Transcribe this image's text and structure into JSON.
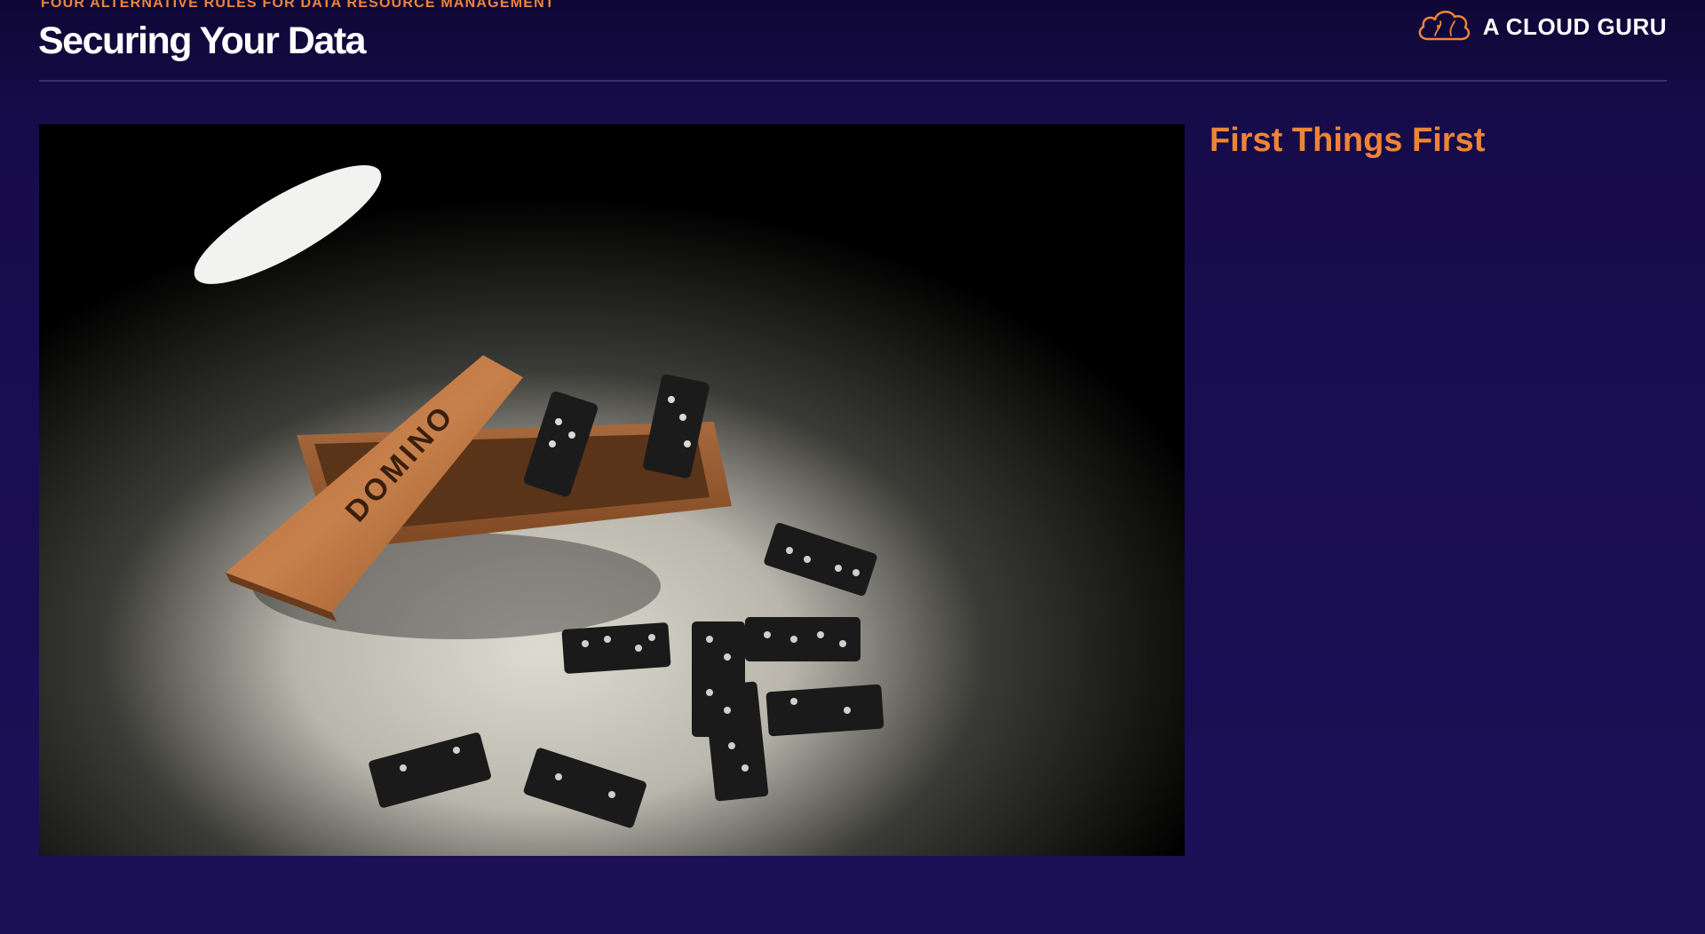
{
  "header": {
    "kicker": "FOUR ALTERNATIVE RULES FOR DATA RESOURCE MANAGEMENT",
    "title": "Securing Your Data",
    "brand": {
      "name": "A CLOUD GURU",
      "logo_icon": "cloud-logo-icon"
    }
  },
  "main": {
    "image": {
      "subject": "dominoes-under-spotlight",
      "box_lid_text": "DOMINO"
    },
    "side_heading": "First Things First"
  },
  "colors": {
    "background": "#1c1058",
    "accent_orange": "#ee8436",
    "title_white": "#ffffff",
    "divider": "#3a3170"
  }
}
